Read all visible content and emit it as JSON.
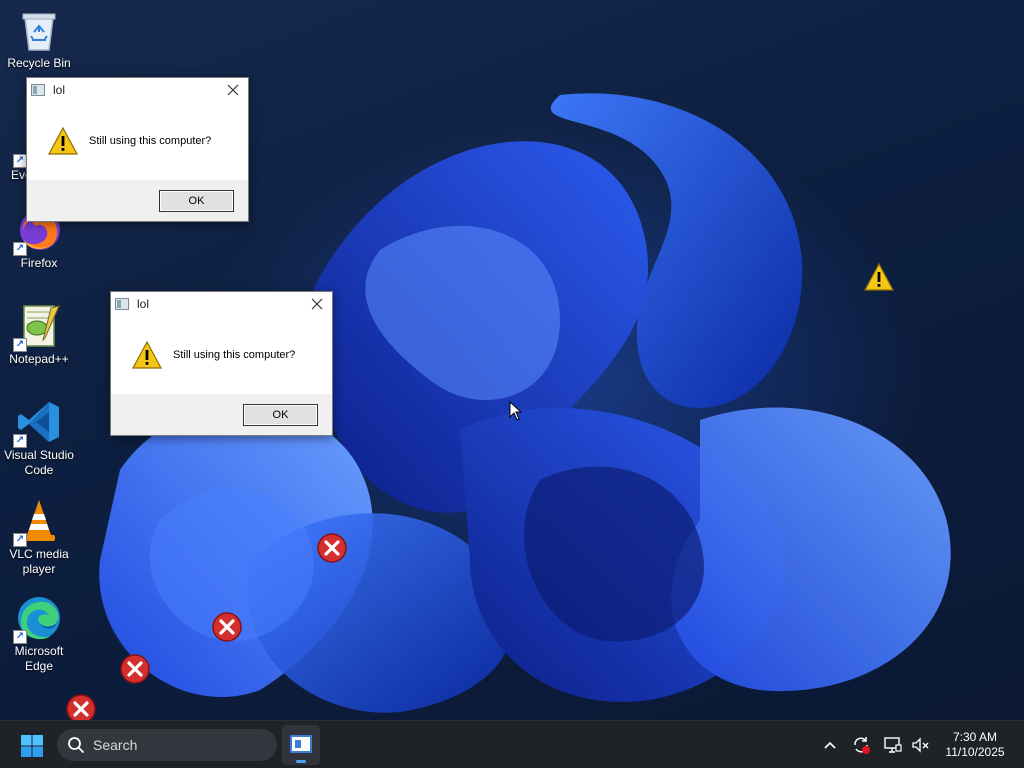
{
  "desktop": {
    "icons": [
      {
        "label": "Recycle Bin"
      },
      {
        "label": "Eve"
      },
      {
        "label": "Firefox"
      },
      {
        "label": "Notepad++"
      },
      {
        "label": "Visual Studio Code"
      },
      {
        "label": "VLC media player"
      },
      {
        "label": "Microsoft Edge"
      }
    ]
  },
  "dialogs": [
    {
      "title": "lol",
      "message": "Still using this computer?",
      "ok_label": "OK"
    },
    {
      "title": "lol",
      "message": "Still using this computer?",
      "ok_label": "OK"
    }
  ],
  "taskbar": {
    "search_label": "Search",
    "time": "7:30 AM",
    "date": "11/10/2025"
  },
  "icons": {
    "start": "windows-start-icon",
    "search": "search-icon",
    "tray": [
      "chevron-up-icon",
      "sync-error-icon",
      "display-icon",
      "speaker-muted-icon"
    ],
    "error": "error-x-icon",
    "warning": "warning-icon"
  },
  "colors": {
    "accent": "#3a7bd5",
    "taskbar": "#1f2328",
    "error_red": "#d32f2f",
    "warning_yellow": "#f5c518"
  }
}
